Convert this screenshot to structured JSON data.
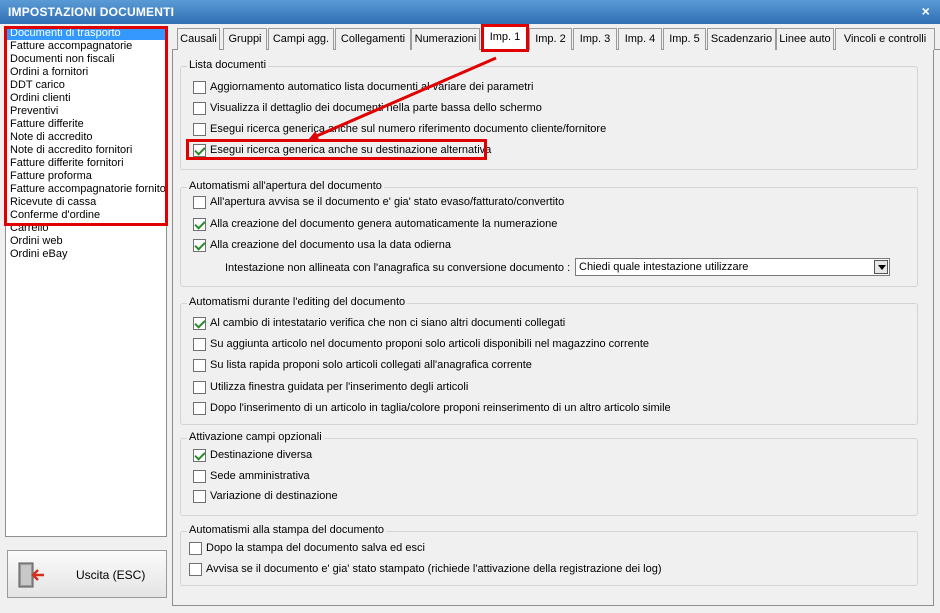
{
  "window": {
    "title": "IMPOSTAZIONI DOCUMENTI",
    "close_glyph": "×"
  },
  "sidebar": {
    "items": [
      "Documenti di trasporto",
      "Fatture accompagnatorie",
      "Documenti non fiscali",
      "Ordini a fornitori",
      "DDT carico",
      "Ordini clienti",
      "Preventivi",
      "Fatture differite",
      "Note di accredito",
      "Note di accredito fornitori",
      "Fatture differite fornitori",
      "Fatture proforma",
      "Fatture accompagnatorie fornito",
      "Ricevute di cassa",
      "Conferme d'ordine",
      "Carrello",
      "Ordini web",
      "Ordini eBay"
    ],
    "selected_index": 0
  },
  "exit_button": {
    "label": "Uscita (ESC)",
    "icon": "exit-door-icon"
  },
  "tabs": [
    "Causali",
    "Gruppi",
    "Campi agg.",
    "Collegamenti",
    "Numerazioni",
    "Imp. 1",
    "Imp. 2",
    "Imp. 3",
    "Imp. 4",
    "Imp. 5",
    "Scadenzario",
    "Linee auto",
    "Vincoli e controlli"
  ],
  "active_tab": "Imp. 1",
  "groups": {
    "lista": {
      "title": "Lista documenti",
      "options": [
        {
          "label": "Aggiornamento automatico lista documenti al variare dei parametri",
          "checked": false
        },
        {
          "label": "Visualizza il dettaglio dei documenti nella parte bassa dello schermo",
          "checked": false
        },
        {
          "label": "Esegui ricerca generica anche sul numero riferimento documento cliente/fornitore",
          "checked": false
        },
        {
          "label": "Esegui ricerca generica anche su destinazione alternativa",
          "checked": true
        }
      ]
    },
    "apertura": {
      "title": "Automatismi all'apertura del documento",
      "options": [
        {
          "label": "All'apertura avvisa se il documento e' gia' stato evaso/fatturato/convertito",
          "checked": false
        },
        {
          "label": "Alla creazione del documento genera automaticamente la numerazione",
          "checked": true
        },
        {
          "label": "Alla creazione del documento usa la data odierna",
          "checked": true
        }
      ],
      "combo_label": "Intestazione non allineata con l'anagrafica su conversione documento :",
      "combo_value": "Chiedi quale intestazione utilizzare"
    },
    "editing": {
      "title": "Automatismi durante l'editing del documento",
      "options": [
        {
          "label": "Al cambio di intestatario verifica che non ci siano altri documenti collegati",
          "checked": true
        },
        {
          "label": "Su aggiunta articolo nel documento proponi solo articoli disponibili nel magazzino corrente",
          "checked": false
        },
        {
          "label": "Su lista rapida proponi solo articoli collegati all'anagrafica corrente",
          "checked": false
        },
        {
          "label": "Utilizza finestra guidata per l'inserimento degli articoli",
          "checked": false
        },
        {
          "label": "Dopo l'inserimento di un articolo in taglia/colore proponi reinserimento di un altro articolo simile",
          "checked": false
        }
      ]
    },
    "campi": {
      "title": "Attivazione campi opzionali",
      "options": [
        {
          "label": "Destinazione diversa",
          "checked": true
        },
        {
          "label": "Sede amministrativa",
          "checked": false
        },
        {
          "label": "Variazione di destinazione",
          "checked": false
        }
      ]
    },
    "stampa": {
      "title": "Automatismi alla stampa del documento",
      "options": [
        {
          "label": "Dopo la stampa del documento salva ed esci",
          "checked": false
        },
        {
          "label": "Avvisa se il documento e' gia' stato stampato (richiede l'attivazione della registrazione dei log)",
          "checked": false
        }
      ]
    }
  },
  "annotation_color": "#e00000"
}
